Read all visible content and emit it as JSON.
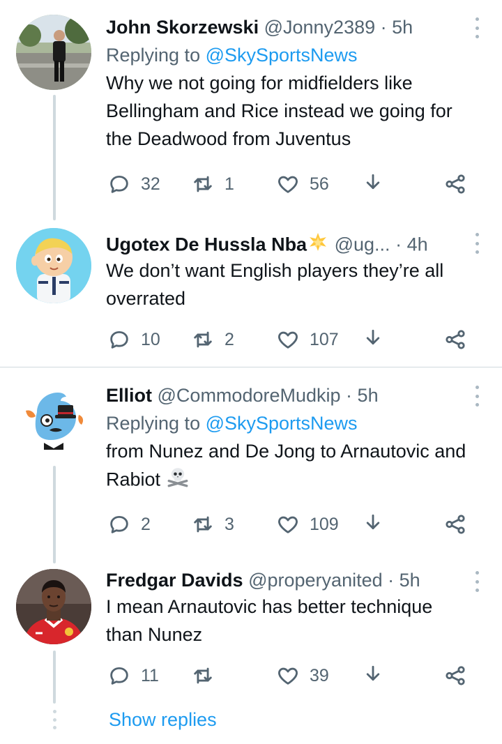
{
  "tweets": [
    {
      "name": "John Skorzewski",
      "handle": "@Jonny2389",
      "separator": "·",
      "time": "5h",
      "replying_prefix": "Replying to ",
      "replying_to": "@SkySportsNews",
      "text": "Why we not going for midfielders like Bellingham and Rice instead we going for the Deadwood from Juventus",
      "replies": "32",
      "retweets": "1",
      "likes": "56",
      "avatar": "man-in-street-photo"
    },
    {
      "name": "Ugotex De Hussla Nba",
      "name_emoji": "star-icon",
      "handle": "@ug...",
      "separator": "·",
      "time": "4h",
      "text": "We don’t want English players they’re all overrated",
      "replies": "10",
      "retweets": "2",
      "likes": "107",
      "avatar": "cartoon-pilot"
    },
    {
      "name": "Elliot",
      "handle": "@CommodoreMudkip",
      "separator": "·",
      "time": "5h",
      "replying_prefix": "Replying to ",
      "replying_to": "@SkySportsNews",
      "text": "from Nunez and De Jong to Arnautovic and Rabiot",
      "text_emoji": "skull-and-crossbones-icon",
      "replies": "2",
      "retweets": "3",
      "likes": "109",
      "avatar": "mudkip-with-top-hat"
    },
    {
      "name": "Fredgar Davids",
      "handle": "@properyanited",
      "separator": "·",
      "time": "5h",
      "text": "I mean Arnautovic has better technique than Nunez",
      "replies": "11",
      "retweets": "",
      "likes": "39",
      "avatar": "footballer-red-shirt"
    }
  ],
  "show_replies": "Show replies",
  "colors": {
    "accent": "#1d9bf0",
    "text": "#0f1419",
    "secondary": "#536471",
    "line": "#cfd9de"
  }
}
